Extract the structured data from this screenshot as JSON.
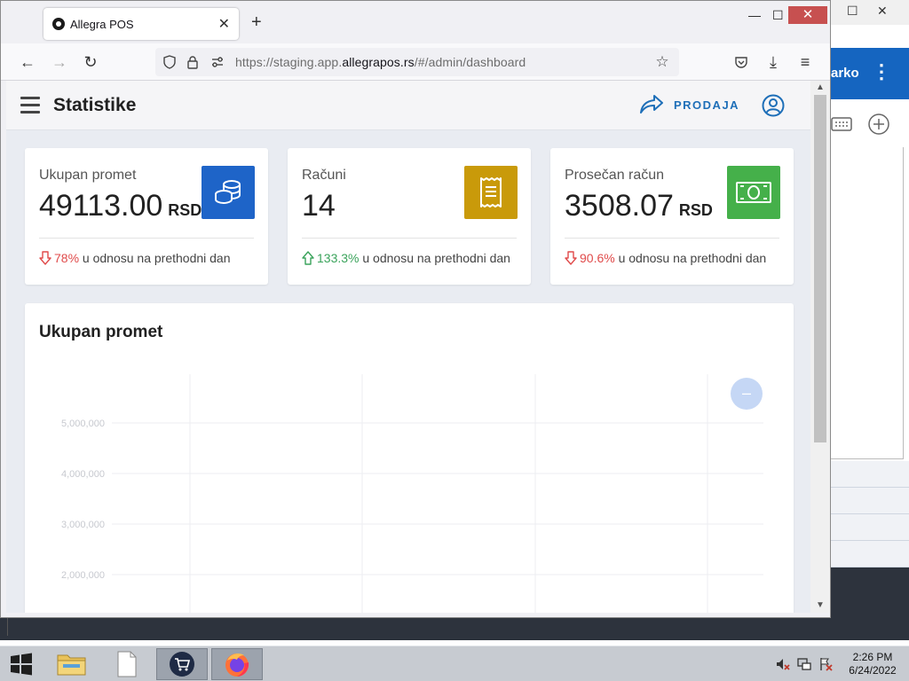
{
  "browser": {
    "tab_title": "Allegra POS",
    "url_scheme": "https://staging.app.",
    "url_host": "allegrapos.rs",
    "url_path": "/#/admin/dashboard"
  },
  "background_window": {
    "user_name": "arko"
  },
  "app": {
    "title": "Statistike",
    "prodaja_label": "PRODAJA"
  },
  "cards": [
    {
      "label": "Ukupan promet",
      "value": "49113.00",
      "unit": "RSD",
      "trend_pct": "78%",
      "trend_dir": "down",
      "trend_text": " u odnosu na prethodni dan",
      "icon": "coins-icon",
      "color": "#1e64c8"
    },
    {
      "label": "Računi",
      "value": "14",
      "unit": "",
      "trend_pct": "133.3%",
      "trend_dir": "up",
      "trend_text": " u odnosu na prethodni dan",
      "icon": "receipt-icon",
      "color": "#c99a0a"
    },
    {
      "label": "Prosečan račun",
      "value": "3508.07",
      "unit": "RSD",
      "trend_pct": "90.6%",
      "trend_dir": "down",
      "trend_text": " u odnosu na prethodni dan",
      "icon": "banknote-icon",
      "color": "#45b04a"
    }
  ],
  "chart": {
    "title": "Ukupan promet",
    "y_ticks": [
      "5,000,000",
      "4,000,000",
      "3,000,000",
      "2,000,000"
    ]
  },
  "chart_data": {
    "type": "line",
    "title": "Ukupan promet",
    "y_ticks": [
      5000000,
      4000000,
      3000000,
      2000000
    ],
    "grid": true
  },
  "taskbar": {
    "time": "2:26 PM",
    "date": "6/24/2022"
  }
}
